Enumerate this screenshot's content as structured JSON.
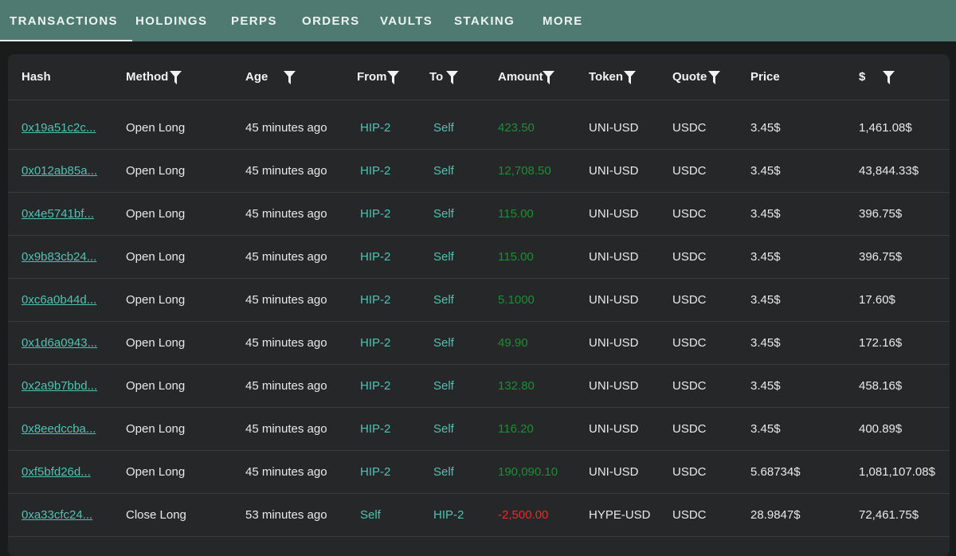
{
  "tabs": [
    {
      "label": "TRANSACTIONS",
      "active": true
    },
    {
      "label": "HOLDINGS"
    },
    {
      "label": "PERPS"
    },
    {
      "label": "ORDERS"
    },
    {
      "label": "VAULTS"
    },
    {
      "label": "STAKING"
    },
    {
      "label": "MORE"
    }
  ],
  "table": {
    "columns": [
      "Hash",
      "Method",
      "Age",
      "From",
      "To",
      "Amount",
      "Token",
      "Quote",
      "Price",
      "$"
    ],
    "filterable": [
      "Method",
      "Age",
      "From",
      "To",
      "Amount",
      "Token",
      "Quote",
      "$"
    ],
    "rows": [
      {
        "hash": "0x19a51c2c...",
        "method": "Open Long",
        "age": "45 minutes ago",
        "from": "HIP-2",
        "to": "Self",
        "amount": "423.50",
        "token": "UNI-USD",
        "quote": "USDC",
        "price": "3.45$",
        "usd": "1,461.08$",
        "amount_sign": "positive"
      },
      {
        "hash": "0x012ab85a...",
        "method": "Open Long",
        "age": "45 minutes ago",
        "from": "HIP-2",
        "to": "Self",
        "amount": "12,708.50",
        "token": "UNI-USD",
        "quote": "USDC",
        "price": "3.45$",
        "usd": "43,844.33$",
        "amount_sign": "positive"
      },
      {
        "hash": "0x4e5741bf...",
        "method": "Open Long",
        "age": "45 minutes ago",
        "from": "HIP-2",
        "to": "Self",
        "amount": "115.00",
        "token": "UNI-USD",
        "quote": "USDC",
        "price": "3.45$",
        "usd": "396.75$",
        "amount_sign": "positive"
      },
      {
        "hash": "0x9b83cb24...",
        "method": "Open Long",
        "age": "45 minutes ago",
        "from": "HIP-2",
        "to": "Self",
        "amount": "115.00",
        "token": "UNI-USD",
        "quote": "USDC",
        "price": "3.45$",
        "usd": "396.75$",
        "amount_sign": "positive"
      },
      {
        "hash": "0xc6a0b44d...",
        "method": "Open Long",
        "age": "45 minutes ago",
        "from": "HIP-2",
        "to": "Self",
        "amount": "5.1000",
        "token": "UNI-USD",
        "quote": "USDC",
        "price": "3.45$",
        "usd": "17.60$",
        "amount_sign": "positive"
      },
      {
        "hash": "0x1d6a0943...",
        "method": "Open Long",
        "age": "45 minutes ago",
        "from": "HIP-2",
        "to": "Self",
        "amount": "49.90",
        "token": "UNI-USD",
        "quote": "USDC",
        "price": "3.45$",
        "usd": "172.16$",
        "amount_sign": "positive"
      },
      {
        "hash": "0x2a9b7bbd...",
        "method": "Open Long",
        "age": "45 minutes ago",
        "from": "HIP-2",
        "to": "Self",
        "amount": "132.80",
        "token": "UNI-USD",
        "quote": "USDC",
        "price": "3.45$",
        "usd": "458.16$",
        "amount_sign": "positive"
      },
      {
        "hash": "0x8eedccba...",
        "method": "Open Long",
        "age": "45 minutes ago",
        "from": "HIP-2",
        "to": "Self",
        "amount": "116.20",
        "token": "UNI-USD",
        "quote": "USDC",
        "price": "3.45$",
        "usd": "400.89$",
        "amount_sign": "positive"
      },
      {
        "hash": "0xf5bfd26d...",
        "method": "Open Long",
        "age": "45 minutes ago",
        "from": "HIP-2",
        "to": "Self",
        "amount": "190,090.10",
        "token": "UNI-USD",
        "quote": "USDC",
        "price": "5.68734$",
        "usd": "1,081,107.08$",
        "amount_sign": "positive"
      },
      {
        "hash": "0xa33cfc24...",
        "method": "Close Long",
        "age": "53 minutes ago",
        "from": "Self",
        "to": "HIP-2",
        "amount": "-2,500.00",
        "token": "HYPE-USD",
        "quote": "USDC",
        "price": "28.9847$",
        "usd": "72,461.75$",
        "amount_sign": "negative"
      }
    ]
  },
  "colors": {
    "tabbar": "#4e7a71",
    "link": "#4fc3b3",
    "positive": "#1b8f33",
    "negative": "#ee2a2a",
    "panel": "#252728"
  }
}
